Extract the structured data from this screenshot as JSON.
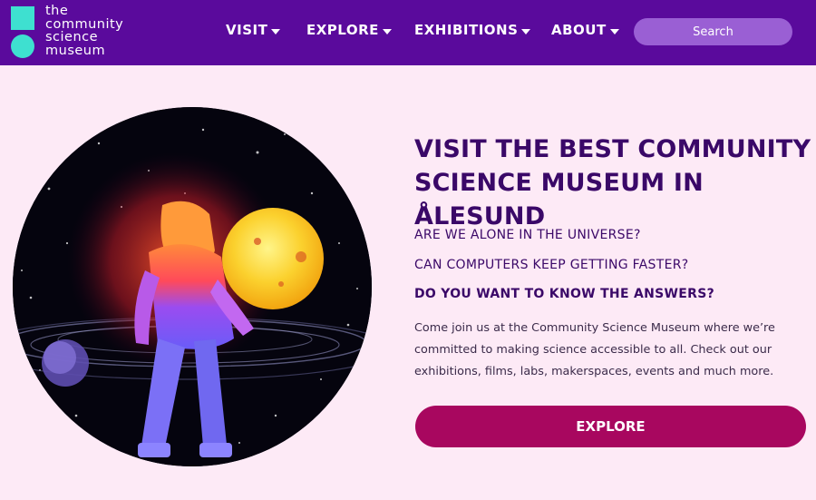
{
  "brand": {
    "logo_lines": [
      "the",
      "community",
      "science",
      "museum"
    ],
    "accent_color": "#3ee0d0",
    "nav_color": "#5a0a9c"
  },
  "nav": {
    "items": [
      {
        "label": "VISIT",
        "icon": "caret-down-icon"
      },
      {
        "label": "EXPLORE",
        "icon": "caret-down-icon"
      },
      {
        "label": "EXHIBITIONS",
        "icon": "caret-down-icon"
      },
      {
        "label": "ABOUT",
        "icon": "caret-down-icon"
      }
    ],
    "search_placeholder": "Search"
  },
  "hero": {
    "headline": "VISIT THE BEST COMMUNITY SCIENCE MUSEUM IN ÅLESUND",
    "questions": [
      "ARE WE ALONE IN THE UNIVERSE?",
      "CAN COMPUTERS KEEP GETTING FASTER?",
      "DO YOU WANT TO KNOW THE ANSWERS?"
    ],
    "description": "Come join us at the Community Science Museum where we’re committed to making science accessible to all. Check out our exhibitions, films, labs, makerspaces, events and much more.",
    "button_label": "EXPLORE",
    "button_color": "#a8075f",
    "headline_color": "#3a0868"
  }
}
